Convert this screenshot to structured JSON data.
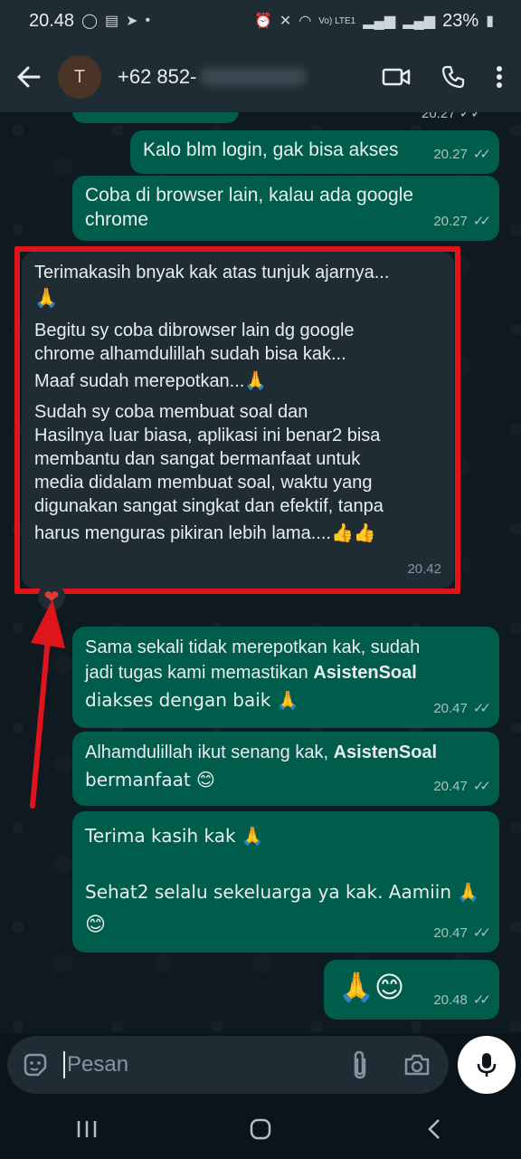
{
  "status": {
    "time": "20.48",
    "battery": "23%",
    "network": "Vo) LTE1"
  },
  "header": {
    "avatar_initial": "T",
    "contact_prefix": "+62 852-"
  },
  "messages": [
    {
      "id": "m0",
      "type": "out",
      "lines": [
        "Kalo blm login, gak bisa akses"
      ],
      "time": "20.27"
    },
    {
      "id": "m1",
      "type": "out",
      "lines": [
        "Coba di browser lain, kalau ada google",
        "chrome"
      ],
      "time": "20.27"
    },
    {
      "id": "m2",
      "type": "in",
      "lines": [
        "Terimakasih bnyak kak atas tunjuk ajarnya...",
        "🙏",
        "Begitu sy coba dibrowser lain dg google",
        "chrome alhamdulillah sudah bisa kak...",
        "Maaf sudah merepotkan...🙏",
        "Sudah sy coba membuat soal dan",
        "Hasilnya luar biasa, aplikasi ini benar2 bisa",
        "membantu dan sangat bermanfaat untuk",
        "media didalam membuat soal, waktu yang",
        "digunakan sangat singkat dan efektif, tanpa",
        "harus menguras pikiran lebih lama....👍👍"
      ],
      "time": "20.42"
    },
    {
      "id": "m3",
      "type": "out",
      "time": "20.47",
      "line1": "Sama sekali tidak merepotkan kak, sudah",
      "line2a": "jadi tugas kami memastikan ",
      "line2b": "AsistenSoal",
      "line3": "diakses dengan baik 🙏"
    },
    {
      "id": "m4",
      "type": "out",
      "time": "20.47",
      "line1a": "Alhamdulillah ikut senang kak, ",
      "line1b": "AsistenSoal",
      "line2": "bermanfaat 😊"
    },
    {
      "id": "m5",
      "type": "out",
      "time": "20.47",
      "line1": "Terima kasih kak 🙏",
      "line2": "Sehat2 selalu sekeluarga ya kak. Aamiin 🙏",
      "line3": "😊"
    },
    {
      "id": "m6",
      "type": "out",
      "time": "20.48",
      "text": "🙏😊"
    }
  ],
  "input": {
    "placeholder": "Pesan"
  },
  "colors": {
    "outgoing_bubble": "#005c4b",
    "incoming_bubble": "#1f2c34",
    "highlight": "#e0141b"
  },
  "icons": [
    "back-arrow-icon",
    "video-call-icon",
    "phone-icon",
    "more-options-icon",
    "sticker-icon",
    "attach-icon",
    "camera-icon",
    "mic-icon",
    "heart-icon"
  ]
}
